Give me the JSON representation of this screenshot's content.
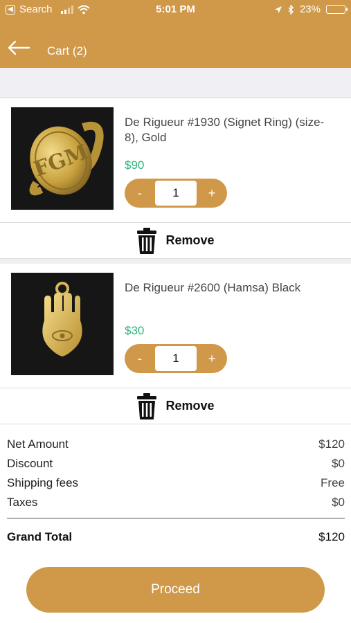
{
  "status_bar": {
    "back_app": "Search",
    "time": "5:01 PM",
    "battery": "23%",
    "battery_level": 0.23
  },
  "header": {
    "title": "Cart (2)"
  },
  "cart_items": [
    {
      "name": "De Rigueur #1930 (Signet Ring) (size-8), Gold",
      "price": "$90",
      "qty": "1",
      "minus_label": "-",
      "plus_label": "+",
      "remove_label": "Remove"
    },
    {
      "name": "De Rigueur #2600 (Hamsa) Black",
      "price": "$30",
      "qty": "1",
      "minus_label": "-",
      "plus_label": "+",
      "remove_label": "Remove"
    }
  ],
  "summary": {
    "net_amount_label": "Net Amount",
    "net_amount": "$120",
    "discount_label": "Discount",
    "discount": "$0",
    "shipping_label": "Shipping fees",
    "shipping": "Free",
    "taxes_label": "Taxes",
    "taxes": "$0",
    "grand_total_label": "Grand Total",
    "grand_total": "$120"
  },
  "proceed_label": "Proceed",
  "colors": {
    "accent": "#d0994a",
    "price": "#2fb37a",
    "background_gray": "#efeff4"
  }
}
